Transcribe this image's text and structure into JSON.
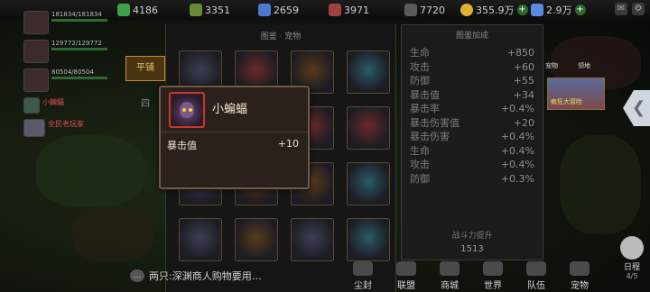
{
  "resources": [
    {
      "name": "gem",
      "value": "4186",
      "color": "#3fa04a"
    },
    {
      "name": "wood",
      "value": "3351",
      "color": "#6a8a3a"
    },
    {
      "name": "crystal",
      "value": "2659",
      "color": "#4a7ad0"
    },
    {
      "name": "ore",
      "value": "3971",
      "color": "#a04040"
    },
    {
      "name": "food",
      "value": "7720",
      "color": "#5a5a5a"
    },
    {
      "name": "gold",
      "value": "355.9万",
      "color": "#e0b030"
    },
    {
      "name": "diamond",
      "value": "2.9万",
      "color": "#5a8ae0"
    }
  ],
  "team": [
    {
      "stats": "181834/181834",
      "name": ""
    },
    {
      "stats": "129772/129772",
      "name": ""
    },
    {
      "stats": "80504/80504",
      "name": ""
    },
    {
      "stats": "",
      "name": "小蝙蝠"
    },
    {
      "stats": "",
      "name": "全民老玩家"
    }
  ],
  "panel": {
    "title": "图鉴 · 宠物",
    "tab_active": "平铺",
    "tab_other": "四"
  },
  "stats_panel": {
    "title": "图鉴加成",
    "rows": [
      {
        "label": "生命",
        "value": "+850"
      },
      {
        "label": "攻击",
        "value": "+60"
      },
      {
        "label": "防御",
        "value": "+55"
      },
      {
        "label": "暴击值",
        "value": "+34"
      },
      {
        "label": "暴击率",
        "value": "+0.4%"
      },
      {
        "label": "暴击伤害值",
        "value": "+20"
      },
      {
        "label": "暴击伤害",
        "value": "+0.4%"
      },
      {
        "label": "生命",
        "value": "+0.4%"
      },
      {
        "label": "攻击",
        "value": "+0.4%"
      },
      {
        "label": "防御",
        "value": "+0.3%"
      }
    ],
    "power_label": "战斗力提升",
    "power_value": "1513"
  },
  "tooltip": {
    "name": "小蝙蝠",
    "stat_label": "暴击值",
    "stat_value": "+10",
    "border_color": "#c43a2a"
  },
  "side": {
    "label_1": "宠物",
    "label_2": "领地",
    "banner_label": "疯狂大冒险"
  },
  "chat": {
    "text": "两只:深渊商人购物要用…"
  },
  "nav": [
    {
      "label": "尘封"
    },
    {
      "label": "联盟"
    },
    {
      "label": "商城"
    },
    {
      "label": "世界"
    },
    {
      "label": "队伍"
    },
    {
      "label": "宠物"
    }
  ],
  "daily": {
    "label": "日程",
    "progress": "4/5"
  }
}
